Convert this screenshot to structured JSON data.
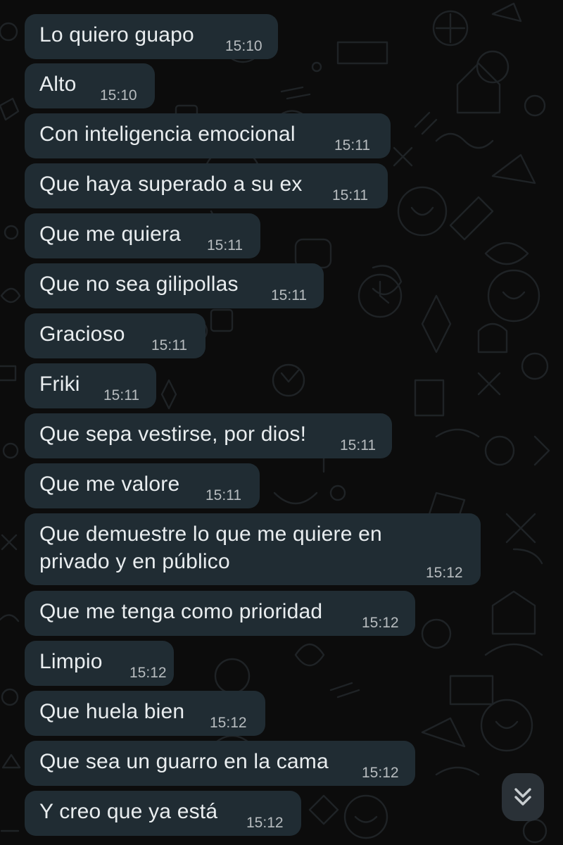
{
  "messages": [
    {
      "text": "Lo quiero guapo",
      "time": "15:10"
    },
    {
      "text": "Alto",
      "time": "15:10"
    },
    {
      "text": "Con inteligencia emocional",
      "time": "15:11"
    },
    {
      "text": "Que haya superado a su ex",
      "time": "15:11"
    },
    {
      "text": "Que me quiera",
      "time": "15:11"
    },
    {
      "text": "Que no sea gilipollas",
      "time": "15:11"
    },
    {
      "text": "Gracioso",
      "time": "15:11"
    },
    {
      "text": "Friki",
      "time": "15:11"
    },
    {
      "text": "Que sepa vestirse, por dios!",
      "time": "15:11"
    },
    {
      "text": "Que me valore",
      "time": "15:11"
    },
    {
      "text_line1": "Que demuestre lo que me quiere en",
      "text_line2": "privado y en público",
      "time": "15:12"
    },
    {
      "text": "Que me tenga como prioridad",
      "time": "15:12"
    },
    {
      "text": "Limpio",
      "time": "15:12"
    },
    {
      "text": "Que huela bien",
      "time": "15:12"
    },
    {
      "text": "Que sea un guarro en la cama",
      "time": "15:12"
    },
    {
      "text": "Y creo que ya está",
      "time": "15:12"
    }
  ],
  "colors": {
    "background": "#0c0c0c",
    "bubble": "#202c33",
    "text": "#e9edef",
    "timestamp": "#b7bcbf",
    "doodle": "#1f2326"
  },
  "icons": {
    "scroll_down": "double-chevron-down-icon"
  }
}
